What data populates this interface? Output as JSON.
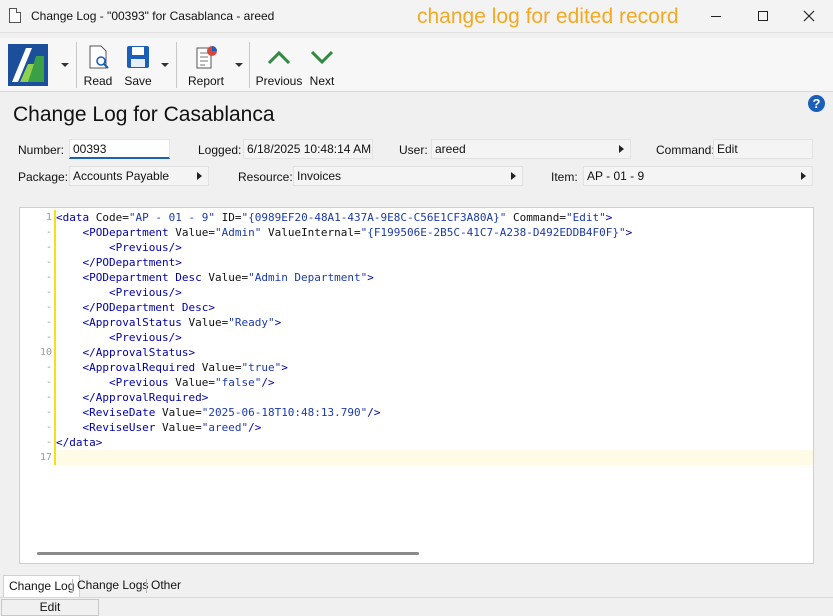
{
  "window": {
    "title": "Change Log - \"00393\" for Casablanca - areed",
    "annotation": "change log for edited record"
  },
  "toolbar": {
    "read_label": "Read",
    "save_label": "Save",
    "report_label": "Report",
    "previous_label": "Previous",
    "next_label": "Next"
  },
  "page": {
    "title": "Change Log for Casablanca",
    "help": "?"
  },
  "fields": {
    "number_label": "Number:",
    "number_value": "00393",
    "logged_label": "Logged:",
    "logged_value": "6/18/2025 10:48:14 AM",
    "user_label": "User:",
    "user_value": "areed",
    "command_label": "Command:",
    "command_value": "Edit",
    "package_label": "Package:",
    "package_value": "Accounts Payable",
    "resource_label": "Resource:",
    "resource_value": "Invoices",
    "item_label": "Item:",
    "item_value": "AP - 01 - 9"
  },
  "editor": {
    "line_numbers": [
      "1",
      "-",
      "-",
      "-",
      "-",
      "-",
      "-",
      "-",
      "-",
      "10",
      "-",
      "-",
      "-",
      "-",
      "-",
      "-",
      "17"
    ],
    "lines": [
      [
        {
          "t": "<data ",
          "c": "tag"
        },
        {
          "t": "Code=",
          "c": "attr"
        },
        {
          "t": "\"AP - 01 - 9\"",
          "c": "val"
        },
        {
          "t": " ID=",
          "c": "attr"
        },
        {
          "t": "\"{0989EF20-48A1-437A-9E8C-C56E1CF3A80A}\"",
          "c": "val"
        },
        {
          "t": " Command=",
          "c": "attr"
        },
        {
          "t": "\"Edit\"",
          "c": "val"
        },
        {
          "t": ">",
          "c": "tag"
        }
      ],
      [
        {
          "t": "    <PODepartment ",
          "c": "tag"
        },
        {
          "t": "Value=",
          "c": "attr"
        },
        {
          "t": "\"Admin\"",
          "c": "val"
        },
        {
          "t": " ValueInternal=",
          "c": "attr"
        },
        {
          "t": "\"{F199506E-2B5C-41C7-A238-D492EDDB4F0F}\"",
          "c": "val"
        },
        {
          "t": ">",
          "c": "tag"
        }
      ],
      [
        {
          "t": "        <Previous/>",
          "c": "tag"
        }
      ],
      [
        {
          "t": "    </PODepartment>",
          "c": "tag"
        }
      ],
      [
        {
          "t": "    <PODepartment Desc ",
          "c": "tag"
        },
        {
          "t": "Value=",
          "c": "attr"
        },
        {
          "t": "\"Admin Department\"",
          "c": "val"
        },
        {
          "t": ">",
          "c": "tag"
        }
      ],
      [
        {
          "t": "        <Previous/>",
          "c": "tag"
        }
      ],
      [
        {
          "t": "    </PODepartment Desc>",
          "c": "tag"
        }
      ],
      [
        {
          "t": "    <ApprovalStatus ",
          "c": "tag"
        },
        {
          "t": "Value=",
          "c": "attr"
        },
        {
          "t": "\"Ready\"",
          "c": "val"
        },
        {
          "t": ">",
          "c": "tag"
        }
      ],
      [
        {
          "t": "        <Previous/>",
          "c": "tag"
        }
      ],
      [
        {
          "t": "    </ApprovalStatus>",
          "c": "tag"
        }
      ],
      [
        {
          "t": "    <ApprovalRequired ",
          "c": "tag"
        },
        {
          "t": "Value=",
          "c": "attr"
        },
        {
          "t": "\"true\"",
          "c": "val"
        },
        {
          "t": ">",
          "c": "tag"
        }
      ],
      [
        {
          "t": "        <Previous ",
          "c": "tag"
        },
        {
          "t": "Value=",
          "c": "attr"
        },
        {
          "t": "\"false\"",
          "c": "val"
        },
        {
          "t": "/>",
          "c": "tag"
        }
      ],
      [
        {
          "t": "    </ApprovalRequired>",
          "c": "tag"
        }
      ],
      [
        {
          "t": "    <ReviseDate ",
          "c": "tag"
        },
        {
          "t": "Value=",
          "c": "attr"
        },
        {
          "t": "\"2025-06-18T10:48:13.790\"",
          "c": "val"
        },
        {
          "t": "/>",
          "c": "tag"
        }
      ],
      [
        {
          "t": "    <ReviseUser ",
          "c": "tag"
        },
        {
          "t": "Value=",
          "c": "attr"
        },
        {
          "t": "\"areed\"",
          "c": "val"
        },
        {
          "t": "/>",
          "c": "tag"
        }
      ],
      [
        {
          "t": "</data>",
          "c": "tag"
        }
      ],
      []
    ]
  },
  "tabs": [
    "Change Log",
    "Change Logs",
    "Other"
  ],
  "status": {
    "mode": "Edit"
  },
  "colors": {
    "accent": "#1c5fb8",
    "annotation": "#f4a923",
    "marker": "#f2e01f",
    "nav_green": "#2e8b3e"
  }
}
